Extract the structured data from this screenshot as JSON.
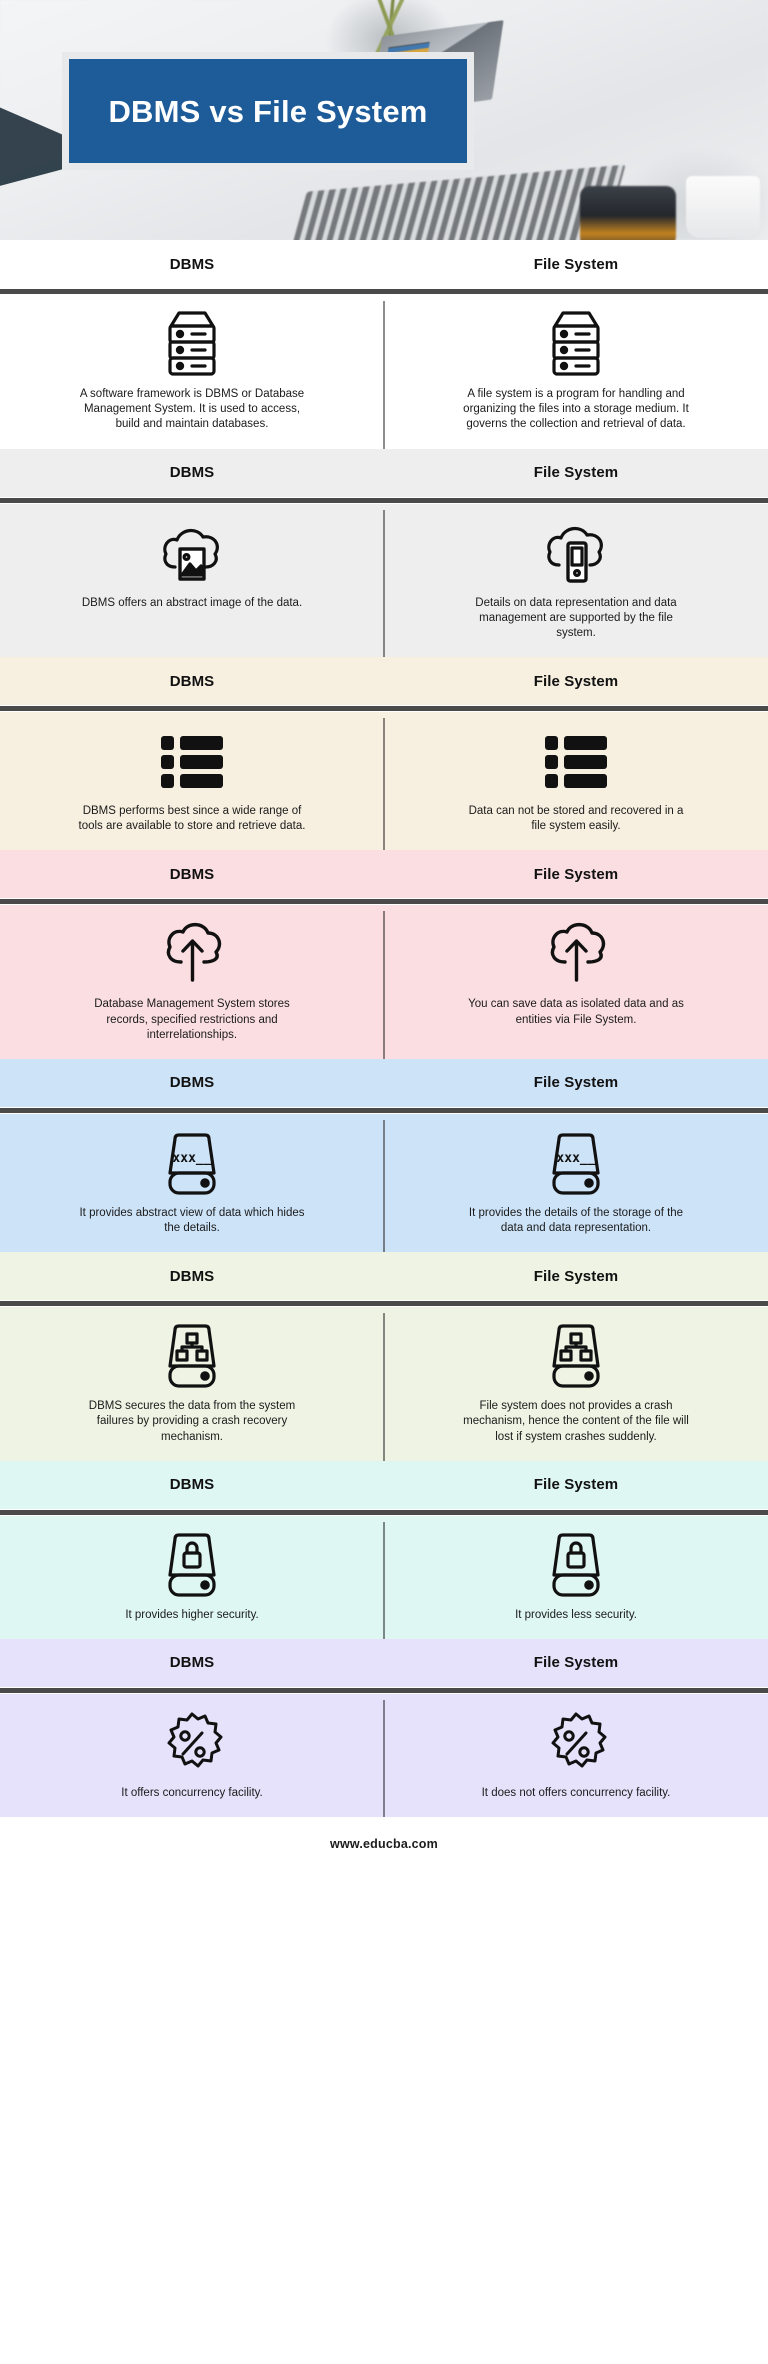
{
  "hero": {
    "title": "DBMS vs File System"
  },
  "column_headers": {
    "left": "DBMS",
    "right": "File System"
  },
  "sections": [
    {
      "background": "#ffffff",
      "icon": "server-rack-icon",
      "left_text": "A software framework is DBMS or Database Management System. It is used to access, build and maintain databases.",
      "right_text": "A file system is a program for handling and organizing the files into a storage medium. It governs the collection and retrieval of data."
    },
    {
      "background": "#eeeeee",
      "icon_left": "cloud-image-icon",
      "icon_right": "cloud-mobile-icon",
      "left_text": "DBMS offers an abstract image of the data.",
      "right_text": "Details on data representation and data management are supported by the file system."
    },
    {
      "background": "#f7efdf",
      "icon": "list-icon",
      "left_text": "DBMS performs best since a wide range of tools are available to store and retrieve data.",
      "right_text": "Data can not be stored and recovered in a file system easily."
    },
    {
      "background": "#fbdee1",
      "icon": "cloud-upload-icon",
      "left_text": "Database Management System stores records, specified restrictions and interrelationships.",
      "right_text": "You can save data as isolated data and as entities via File System."
    },
    {
      "background": "#cde3f8",
      "icon": "password-drive-icon",
      "left_text": "It provides abstract view of data which hides the details.",
      "right_text": "It provides the details of the storage of the data and data representation."
    },
    {
      "background": "#eef3e3",
      "icon": "network-drive-icon",
      "left_text": "DBMS secures the data from the system failures by providing a crash recovery mechanism.",
      "right_text": "File system does not provides a crash mechanism, hence the content of the file will lost if system crashes suddenly."
    },
    {
      "background": "#dff7f2",
      "icon": "lock-drive-icon",
      "left_text": "It provides higher security.",
      "right_text": "It provides less security."
    },
    {
      "background": "#e6e2fb",
      "icon": "percent-badge-icon",
      "left_text": "It offers concurrency facility.",
      "right_text": "It does not offers concurrency facility."
    }
  ],
  "footer": {
    "url": "www.educba.com"
  },
  "colors": {
    "title_bg": "#1d5b99",
    "rule": "#4a4a4a",
    "text": "#1b1b1b"
  }
}
